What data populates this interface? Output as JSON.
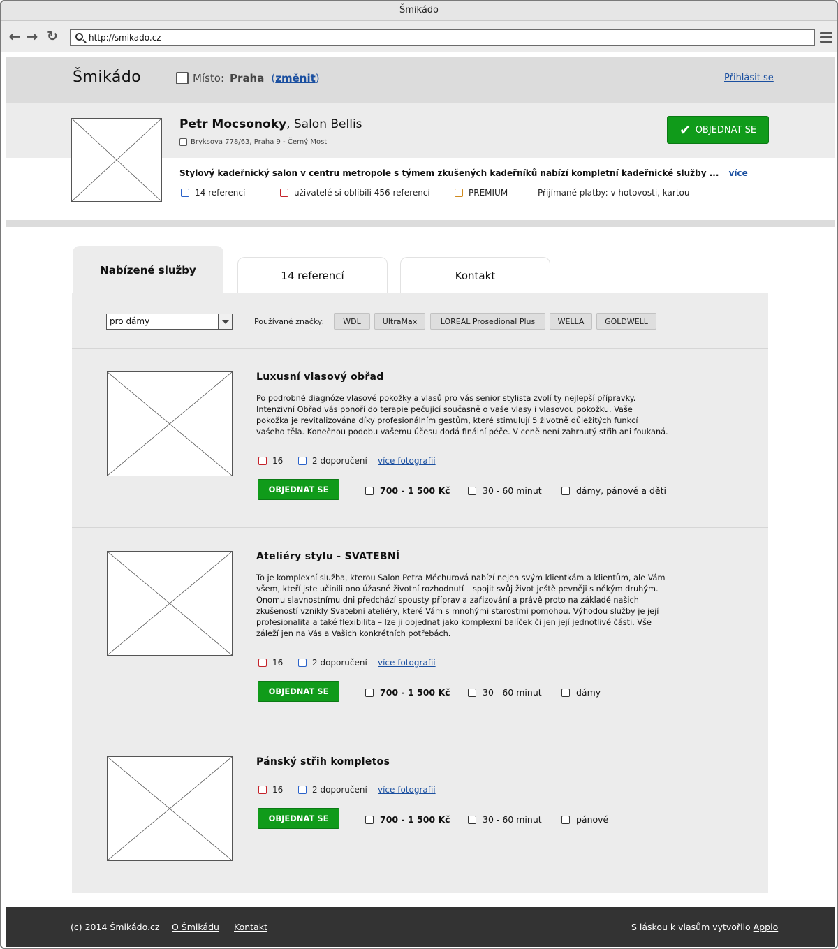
{
  "browser": {
    "title": "Šmikádo",
    "url": "http://smikado.cz"
  },
  "header": {
    "logo": "Šmikádo",
    "location_label": "Místo:",
    "location_city": "Praha",
    "location_change_open": "(",
    "location_change": "změnit",
    "location_change_close": ")",
    "login": "Přihlásit se"
  },
  "salon": {
    "person": "Petr Mocsonoky",
    "salon_name": ", Salon Bellis",
    "address": "Bryksova 778/63, Praha 9 - Černý Most",
    "order_button": "OBJEDNAT SE",
    "description": "Stylový kadeřnický salon v centru metropole s týmem zkušených kadeřníků nabízí kompletní kadeřnické služby ...",
    "more_link": "více",
    "badges": {
      "references": "14 referencí",
      "liked": "uživatelé si oblíbili 456 referencí",
      "premium": "PREMIUM",
      "payments": "Přijímané platby: v hotovosti, kartou"
    },
    "badge_colors": {
      "references": "#2a62c9",
      "liked": "#c4232a",
      "premium": "#d08a1e"
    }
  },
  "tabs": [
    {
      "label": "Nabízené služby"
    },
    {
      "label": "14 referencí"
    },
    {
      "label": "Kontakt"
    }
  ],
  "filters": {
    "selected": "pro dámy",
    "brands_label": "Používané značky:",
    "brands": [
      "WDL",
      "UltraMax",
      "LOREAL Prosedional Plus",
      "WELLA",
      "GOLDWELL"
    ]
  },
  "services": [
    {
      "title": "Luxusní vlasový obřad",
      "description": [
        "Po podrobné diagnóze vlasové pokožky a vlasů pro vás senior stylista zvolí ty nejlepší přípravky.",
        "Intenzivní Obřad vás ponoří do terapie pečující současně o vaše vlasy i vlasovou pokožku. Vaše",
        "pokožka je revitalizována díky profesionálním gestům, které stimulují 5 životně důležitých funkcí",
        "vašeho těla. Konečnou podobu vašemu účesu dodá finální péče. V ceně není zahrnutý střih ani foukaná."
      ],
      "likes": "16",
      "recommendations": "2 doporučení",
      "photos_link": "více fotografií",
      "order_button": "OBJEDNAT SE",
      "price": "700 - 1 500 Kč",
      "duration": "30 - 60 minut",
      "audience": "dámy, pánové a děti"
    },
    {
      "title": "Ateliéry stylu - SVATEBNÍ",
      "description": [
        "To je komplexní služba, kterou Salon Petra Měchurová nabízí nejen svým klientkám a klientům, ale Vám",
        "všem, kteří jste učinili ono úžasné životní rozhodnutí – spojit svůj život ještě pevněji s někým druhým.",
        "Onomu slavnostnímu dni předchází spousty příprav a zařizování a právě proto na základě našich",
        "zkušeností vznikly Svatební ateliéry, které Vám s mnohými starostmi pomohou. Výhodou služby je její",
        "profesionalita a také flexibilita – lze ji objednat jako komplexní balíček či jen její jednotlivé části. Vše",
        "záleží jen na Vás a Vašich konkrétních potřebách."
      ],
      "likes": "16",
      "recommendations": "2 doporučení",
      "photos_link": "více fotografií",
      "order_button": "OBJEDNAT SE",
      "price": "700 - 1 500 Kč",
      "duration": "30 - 60 minut",
      "audience": "dámy"
    },
    {
      "title": "Pánský střih kompletos",
      "likes": "16",
      "recommendations": "2 doporučení",
      "photos_link": "více fotografií",
      "order_button": "OBJEDNAT SE",
      "price": "700 - 1 500 Kč",
      "duration": "30 - 60 minut",
      "audience": "pánové"
    }
  ],
  "footer": {
    "copyright": "(c) 2014 Šmikádo.cz",
    "about": "O Šmikádu",
    "contact": "Kontakt",
    "credit": "S láskou k vlasům vytvořilo",
    "credit_link": "Appio"
  }
}
